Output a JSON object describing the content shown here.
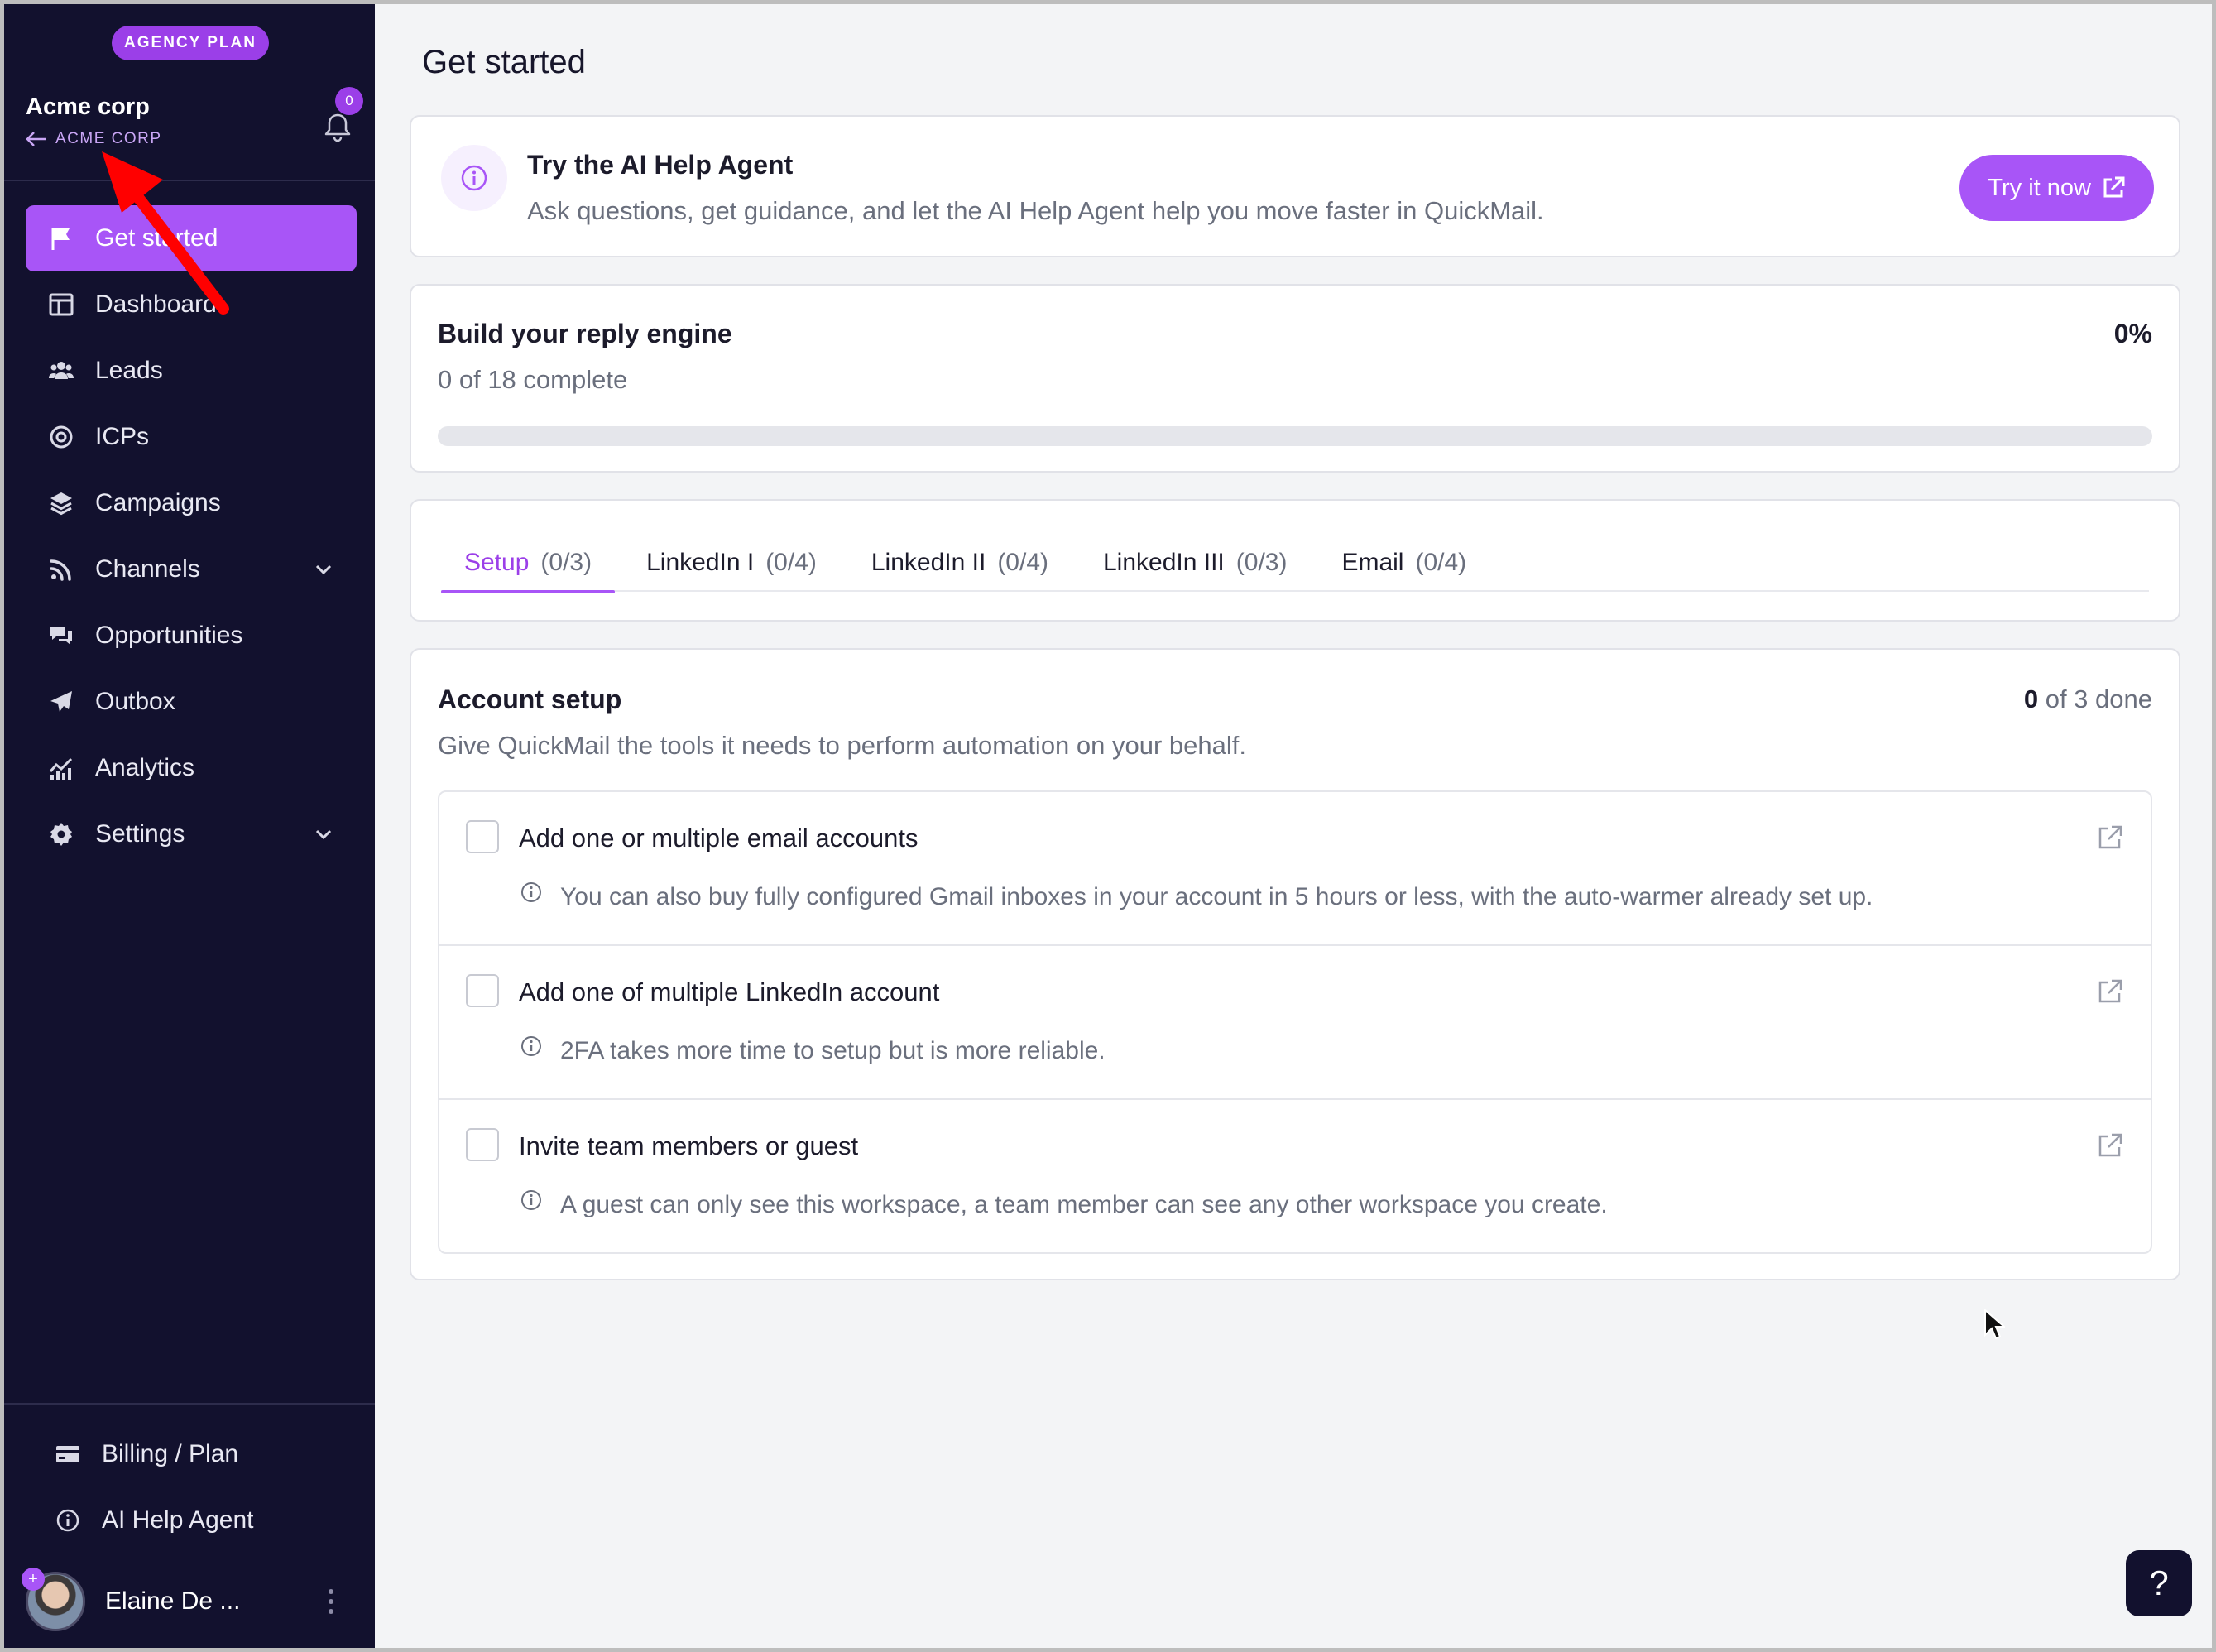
{
  "sidebar": {
    "plan_badge": "AGENCY PLAN",
    "org_name": "Acme corp",
    "org_back_label": "ACME CORP",
    "notification_count": "0",
    "nav": [
      {
        "label": "Get started",
        "icon": "flag-icon"
      },
      {
        "label": "Dashboard",
        "icon": "dashboard-icon"
      },
      {
        "label": "Leads",
        "icon": "users-icon"
      },
      {
        "label": "ICPs",
        "icon": "target-icon"
      },
      {
        "label": "Campaigns",
        "icon": "layers-icon"
      },
      {
        "label": "Channels",
        "icon": "rss-icon"
      },
      {
        "label": "Opportunities",
        "icon": "chat-icon"
      },
      {
        "label": "Outbox",
        "icon": "send-icon"
      },
      {
        "label": "Analytics",
        "icon": "analytics-icon"
      },
      {
        "label": "Settings",
        "icon": "gear-icon"
      }
    ],
    "bottom": [
      {
        "label": "Billing / Plan",
        "icon": "credit-card-icon"
      },
      {
        "label": "AI Help Agent",
        "icon": "info-icon"
      }
    ],
    "user_name": "Elaine De ...",
    "avatar_badge": "+"
  },
  "main": {
    "title": "Get started",
    "ai_card": {
      "title": "Try the AI Help Agent",
      "description": "Ask questions, get guidance, and let the AI Help Agent help you move faster in QuickMail.",
      "button_label": "Try it now"
    },
    "progress": {
      "title": "Build your reply engine",
      "subtitle": "0 of 18 complete",
      "percent_label": "0%",
      "fraction": 0
    },
    "tabs": [
      {
        "label": "Setup",
        "count": "(0/3)"
      },
      {
        "label": "LinkedIn I",
        "count": "(0/4)"
      },
      {
        "label": "LinkedIn II",
        "count": "(0/4)"
      },
      {
        "label": "LinkedIn III",
        "count": "(0/3)"
      },
      {
        "label": "Email",
        "count": "(0/4)"
      }
    ],
    "setup": {
      "title": "Account setup",
      "subtitle": "Give QuickMail the tools it needs to perform automation on your behalf.",
      "done_count": "0",
      "done_suffix": " of 3 done",
      "tasks": [
        {
          "title": "Add one or multiple email accounts",
          "note": "You can also buy fully configured Gmail inboxes in your account in 5 hours or less, with the auto-warmer already set up."
        },
        {
          "title": "Add one of multiple LinkedIn account",
          "note": "2FA takes more time to setup but is more reliable."
        },
        {
          "title": "Invite team members or guest",
          "note": "A guest can only see this workspace, a team member can see any other workspace you create."
        }
      ]
    },
    "help_button": "?"
  },
  "colors": {
    "sidebar_bg": "#12112e",
    "accent": "#a855f7",
    "annotation_arrow": "#ff0000"
  }
}
